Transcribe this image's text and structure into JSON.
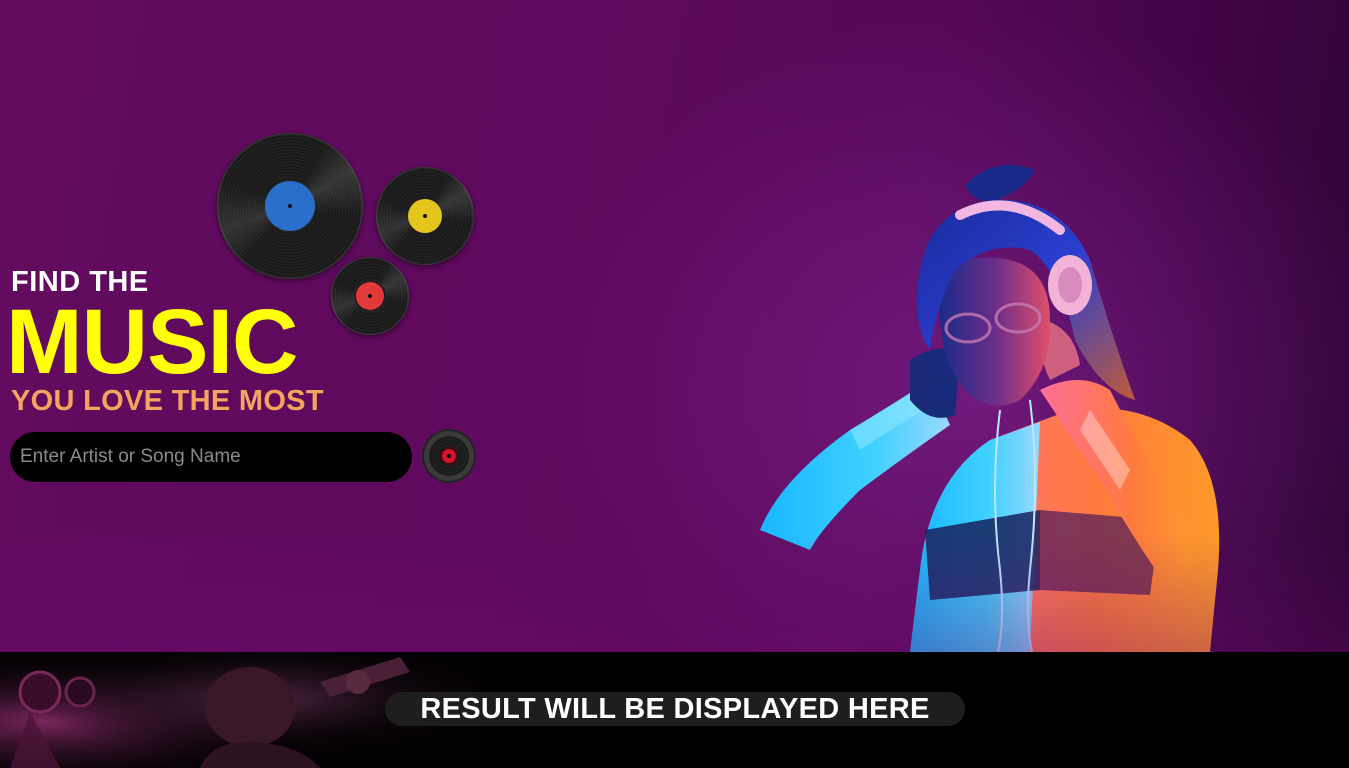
{
  "hero": {
    "heading_line1": "FIND THE",
    "heading_line2": "MUSIC",
    "heading_line3": "YOU LOVE THE MOST"
  },
  "search": {
    "placeholder": "Enter Artist or Song Name",
    "value": ""
  },
  "result": {
    "text": "RESULT WILL BE DISPLAYED HERE"
  },
  "colors": {
    "background": "#5f0a5e",
    "heading_white": "#ffffff",
    "heading_yellow": "#ffff0a",
    "heading_orange": "#f4a45e",
    "record_blue": "#2a6fc9",
    "record_yellow": "#e3c51c",
    "record_red": "#e23a3a"
  },
  "icons": {
    "search_button": "vinyl-record-icon"
  }
}
